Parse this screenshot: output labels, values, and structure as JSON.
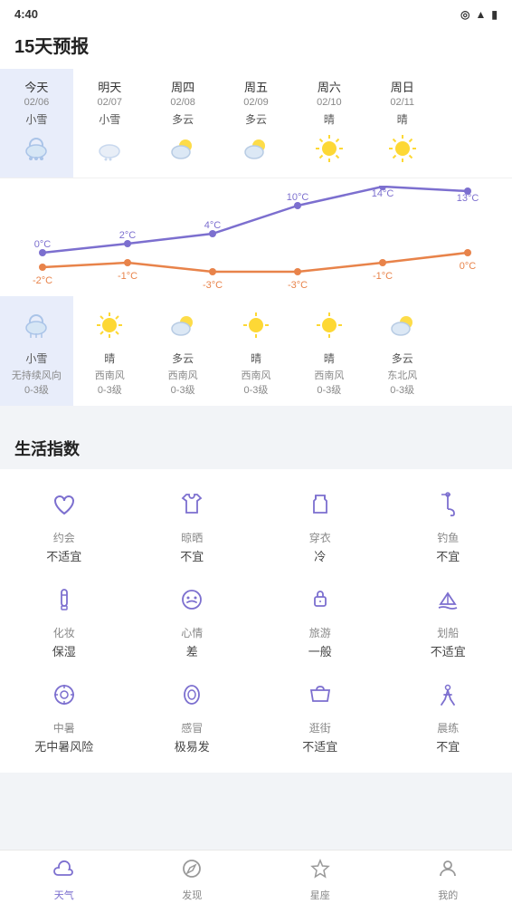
{
  "statusBar": {
    "time": "4:40",
    "icons": [
      "location",
      "wifi",
      "battery"
    ]
  },
  "header": {
    "title": "15天预报"
  },
  "forecast": {
    "days": [
      {
        "name": "今天",
        "date": "02/06",
        "weather": "小雪",
        "iconType": "snow",
        "highTemp": "0°C",
        "lowTemp": "-2°C",
        "bottomWeather": "小雪",
        "wind": "无持续风向",
        "windLevel": "0-3级"
      },
      {
        "name": "明天",
        "date": "02/07",
        "weather": "小雪",
        "iconType": "snow-dot",
        "highTemp": "2°C",
        "lowTemp": "-1°C",
        "bottomWeather": "晴",
        "wind": "西南风",
        "windLevel": "0-3级"
      },
      {
        "name": "周四",
        "date": "02/08",
        "weather": "多云",
        "iconType": "cloud-sun",
        "highTemp": "4°C",
        "lowTemp": "-3°C",
        "bottomWeather": "多云",
        "wind": "西南风",
        "windLevel": "0-3级"
      },
      {
        "name": "周五",
        "date": "02/09",
        "weather": "多云",
        "iconType": "cloud-sun",
        "highTemp": "10°C",
        "lowTemp": "-3°C",
        "bottomWeather": "晴",
        "wind": "西南风",
        "windLevel": "0-3级"
      },
      {
        "name": "周六",
        "date": "02/10",
        "weather": "晴",
        "iconType": "sun",
        "highTemp": "14°C",
        "lowTemp": "-1°C",
        "bottomWeather": "晴",
        "wind": "西南风",
        "windLevel": "0-3级"
      },
      {
        "name": "周日",
        "date": "02/11",
        "weather": "晴",
        "iconType": "sun",
        "highTemp": "13°C",
        "lowTemp": "0°C",
        "bottomWeather": "多云",
        "wind": "东北风",
        "windLevel": "0-3级"
      }
    ]
  },
  "lifeIndex": {
    "title": "生活指数",
    "items": [
      {
        "name": "约会",
        "value": "不适宜",
        "icon": "heart-icon"
      },
      {
        "name": "晾晒",
        "value": "不宜",
        "icon": "tshirt-icon"
      },
      {
        "name": "穿衣",
        "value": "冷",
        "icon": "clothes-icon"
      },
      {
        "name": "钓鱼",
        "value": "不宜",
        "icon": "fishing-icon"
      },
      {
        "name": "化妆",
        "value": "保湿",
        "icon": "makeup-icon"
      },
      {
        "name": "心情",
        "value": "差",
        "icon": "mood-icon"
      },
      {
        "name": "旅游",
        "value": "一般",
        "icon": "travel-icon"
      },
      {
        "name": "划船",
        "value": "不适宜",
        "icon": "boat-icon"
      },
      {
        "name": "中暑",
        "value": "无中暑风险",
        "icon": "heatstroke-icon"
      },
      {
        "name": "感冒",
        "value": "极易发",
        "icon": "cold-icon"
      },
      {
        "name": "逛街",
        "value": "不适宜",
        "icon": "shopping-icon"
      },
      {
        "name": "晨练",
        "value": "不宜",
        "icon": "exercise-icon"
      }
    ]
  },
  "bottomNav": [
    {
      "label": "天气",
      "icon": "cloud-nav",
      "active": true
    },
    {
      "label": "发现",
      "icon": "compass-nav",
      "active": false
    },
    {
      "label": "星座",
      "icon": "star-nav",
      "active": false
    },
    {
      "label": "我的",
      "icon": "user-nav",
      "active": false
    }
  ]
}
